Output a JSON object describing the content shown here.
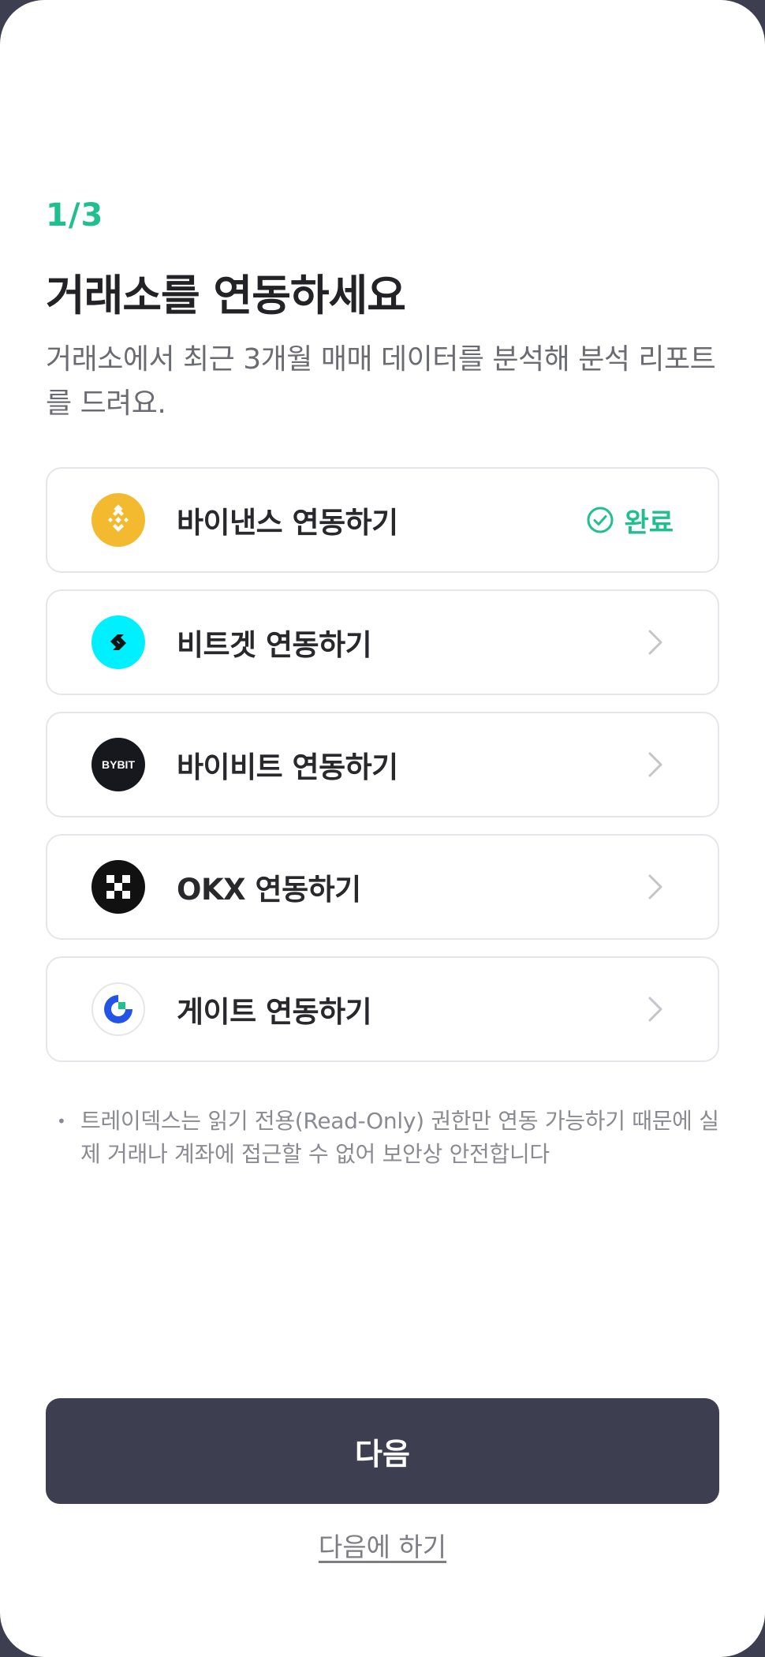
{
  "header": {
    "step": "1/3",
    "title": "거래소를 연동하세요",
    "subtitle": "거래소에서 최근 3개월 매매 데이터를 분석해 분석 리포트를 드려요."
  },
  "exchanges": [
    {
      "label": "바이낸스 연동하기",
      "icon": "binance-logo",
      "status": "완료",
      "connected": true
    },
    {
      "label": "비트겟 연동하기",
      "icon": "bitget-logo",
      "connected": false
    },
    {
      "label": "바이비트 연동하기",
      "icon": "bybit-logo",
      "logo_text": "BYBIT",
      "connected": false
    },
    {
      "label": "OKX 연동하기",
      "icon": "okx-logo",
      "connected": false
    },
    {
      "label": "게이트 연동하기",
      "icon": "gate-logo",
      "connected": false
    }
  ],
  "notice": {
    "bullet": "•",
    "text": "트레이덱스는 읽기 전용(Read-Only) 권한만 연동 가능하기 때문에 실제 거래나 계좌에 접근할 수 없어 보안상 안전합니다"
  },
  "actions": {
    "next_label": "다음",
    "later_label": "다음에 하기"
  },
  "colors": {
    "accent": "#1fbf8f",
    "primary_button": "#3d3e50",
    "binance": "#f3ba2f",
    "bitget": "#00f0ff",
    "gate": "#2354e6"
  }
}
